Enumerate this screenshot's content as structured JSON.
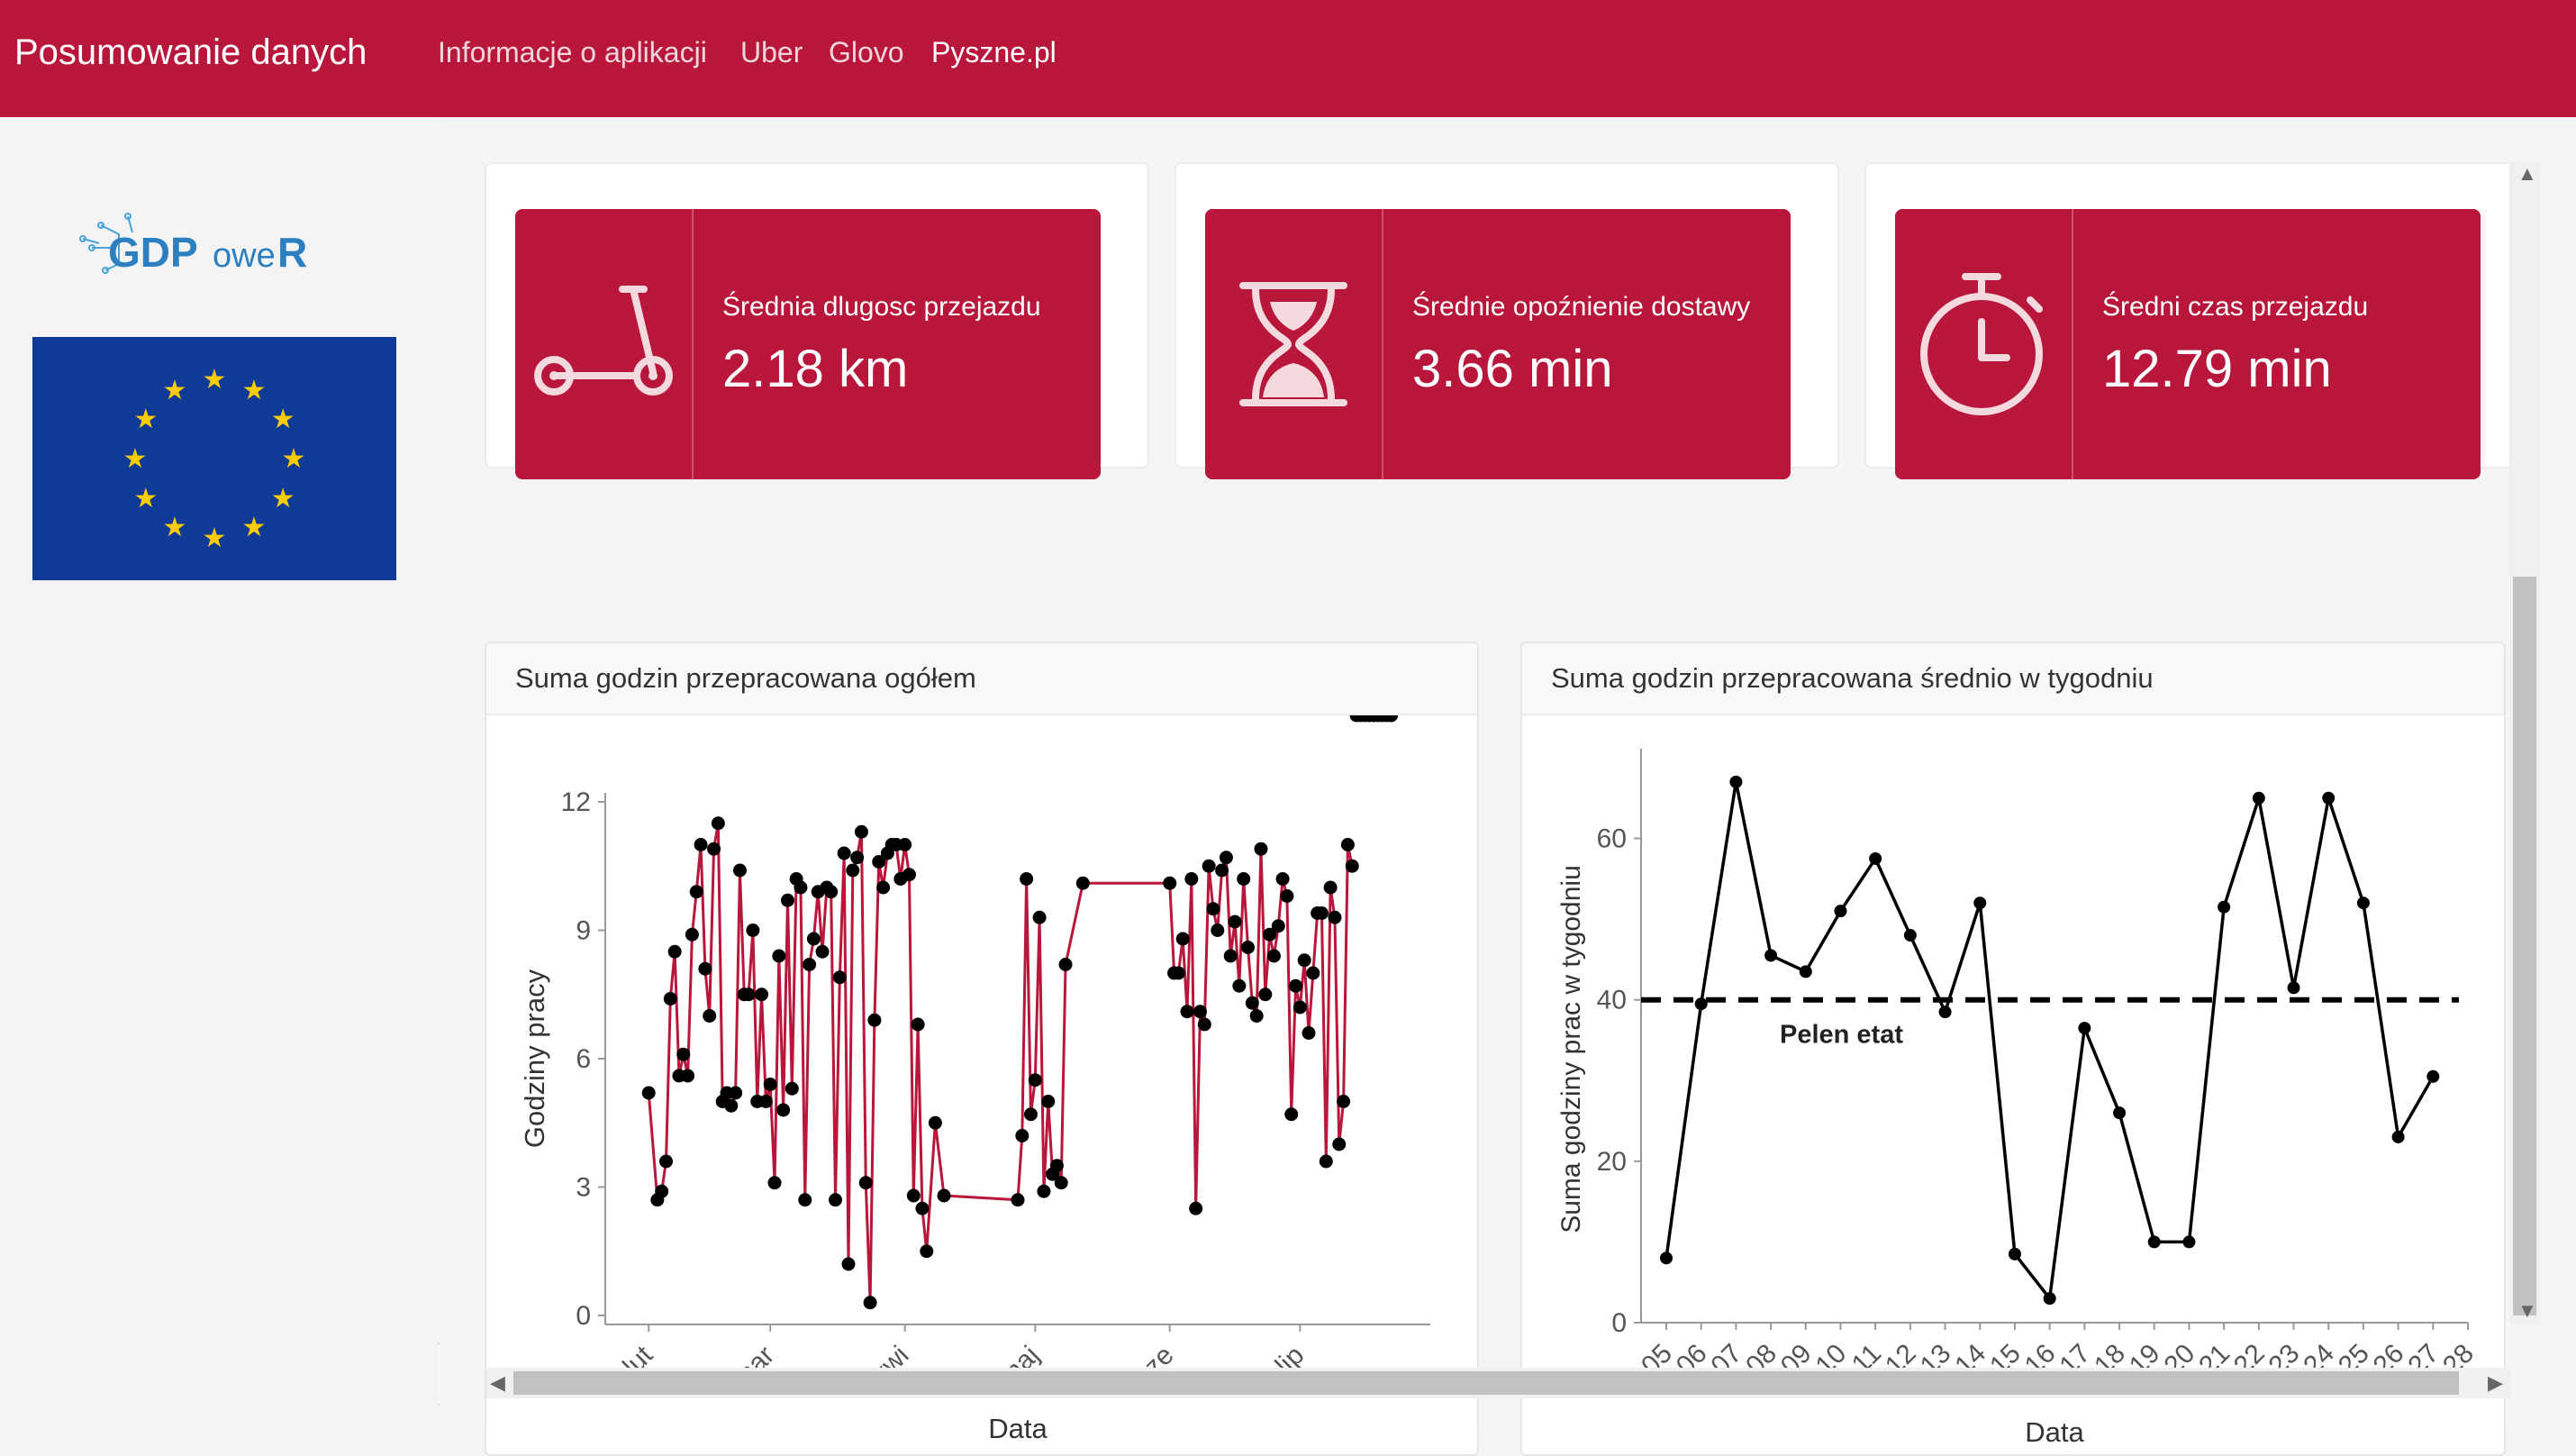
{
  "header": {
    "brand": "Posumowanie danych",
    "nav": [
      "Informacje o aplikacji",
      "Uber",
      "Glovo",
      "Pyszne.pl"
    ],
    "active_nav": "Pyszne.pl",
    "color": "#b8163a"
  },
  "sidebar": {
    "logo_text": {
      "gdp": "GDP",
      "ower": "owe",
      "r": "R"
    },
    "flag_color": "#0f3a96",
    "star_color": "#ffcc00"
  },
  "kpis": [
    {
      "icon": "scooter-icon",
      "label": "Średnia dlugosc przejazdu",
      "value": "2.18 km"
    },
    {
      "icon": "hourglass-icon",
      "label": "Średnie opoźnienie dostawy",
      "value": "3.66 min"
    },
    {
      "icon": "stopwatch-icon",
      "label": "Średni czas przejazdu",
      "value": "12.79 min"
    }
  ],
  "charts": {
    "left_title": "Suma godzin przepracowana ogółem",
    "right_title": "Suma godzin przepracowana średnio w tygodniu"
  },
  "chart_data": [
    {
      "type": "line",
      "title": "Suma godzin przepracowana ogółem",
      "xlabel": "Data",
      "ylabel": "Godziny pracy",
      "ylim": [
        0,
        12
      ],
      "yticks": [
        "0",
        "3",
        "6",
        "9",
        "12"
      ],
      "xticks": [
        "lut",
        "mar",
        "kwi",
        "maj",
        "cze",
        "lip"
      ],
      "line_color": "#b8163a",
      "x_units": "day index (0 = 1 lut)",
      "x": [
        0,
        2,
        3,
        4,
        5,
        6,
        7,
        8,
        9,
        10,
        11,
        12,
        13,
        14,
        15,
        16,
        17,
        18,
        19,
        20,
        21,
        22,
        23,
        24,
        25,
        26,
        27,
        28,
        29,
        30,
        31,
        32,
        33,
        34,
        35,
        36,
        37,
        38,
        39,
        40,
        41,
        42,
        43,
        44,
        45,
        46,
        47,
        48,
        49,
        50,
        51,
        52,
        53,
        54,
        55,
        56,
        57,
        58,
        59,
        60,
        61,
        62,
        63,
        64,
        66,
        68,
        85,
        86,
        87,
        88,
        89,
        90,
        91,
        92,
        93,
        94,
        95,
        96,
        100,
        120,
        121,
        122,
        123,
        124,
        125,
        126,
        127,
        128,
        129,
        130,
        131,
        132,
        133,
        134,
        135,
        136,
        137,
        138,
        139,
        140,
        141,
        142,
        143,
        144,
        145,
        146,
        147,
        148,
        149,
        150,
        151,
        152,
        153,
        154,
        155,
        156,
        157,
        158,
        159,
        160,
        161,
        162,
        163,
        164,
        165,
        166,
        167,
        168,
        169,
        170,
        171
      ],
      "y": [
        5.2,
        2.7,
        2.9,
        3.6,
        7.4,
        8.5,
        5.6,
        6.1,
        5.6,
        8.9,
        9.9,
        11.0,
        8.1,
        7.0,
        10.9,
        11.5,
        5.0,
        5.2,
        4.9,
        5.2,
        10.4,
        7.5,
        7.5,
        9.0,
        5.0,
        7.5,
        5.0,
        5.4,
        3.1,
        8.4,
        4.8,
        9.7,
        5.3,
        10.2,
        10.0,
        2.7,
        8.2,
        8.8,
        9.9,
        8.5,
        10.0,
        9.9,
        2.7,
        7.9,
        10.8,
        1.2,
        10.4,
        10.7,
        11.3,
        3.1,
        0.3,
        6.9,
        10.6,
        10.0,
        10.8,
        11.0,
        11.0,
        10.2,
        11.0,
        10.3,
        2.8,
        6.8,
        2.5,
        1.5,
        4.5,
        2.8,
        2.7,
        4.2,
        10.2,
        4.7,
        5.5,
        9.3,
        2.9,
        5.0,
        3.3,
        3.5,
        3.1,
        8.2,
        10.1,
        10.1,
        8.0,
        8.0,
        8.8,
        7.1,
        10.2,
        2.5,
        7.1,
        6.8,
        10.5,
        9.5,
        9.0,
        10.4,
        10.7,
        8.4,
        9.2,
        7.7,
        10.2,
        8.6,
        7.3,
        7.0,
        10.9,
        7.5,
        8.9,
        8.4,
        9.1,
        10.2,
        9.8,
        4.7,
        7.7,
        7.2,
        8.3,
        6.6,
        8.0,
        9.4,
        9.4,
        3.6,
        10.0,
        9.3,
        4.0,
        5.0,
        11.0,
        10.5
      ]
    },
    {
      "type": "line",
      "title": "Suma godzin przepracowana średnio w tygodniu",
      "xlabel": "Data",
      "ylabel": "Suma godziny prac w  tygodniu",
      "ylim": [
        0,
        70
      ],
      "yticks": [
        "0",
        "20",
        "40",
        "60"
      ],
      "categories": [
        "05",
        "06",
        "07",
        "08",
        "09",
        "10",
        "11",
        "12",
        "13",
        "14",
        "15",
        "16",
        "17",
        "18",
        "19",
        "20",
        "21",
        "22",
        "23",
        "24",
        "25",
        "26",
        "27",
        "28"
      ],
      "values": [
        8,
        39.5,
        67,
        45.5,
        43.5,
        51,
        57.5,
        48,
        38.5,
        52,
        8.5,
        3,
        36.5,
        26,
        10,
        10,
        51.5,
        65,
        41.5,
        65,
        52,
        23,
        30.5,
        null
      ],
      "reference_line": {
        "value": 40,
        "label": "Pelen etat",
        "style": "dashed"
      },
      "line_color": "#000000"
    }
  ]
}
